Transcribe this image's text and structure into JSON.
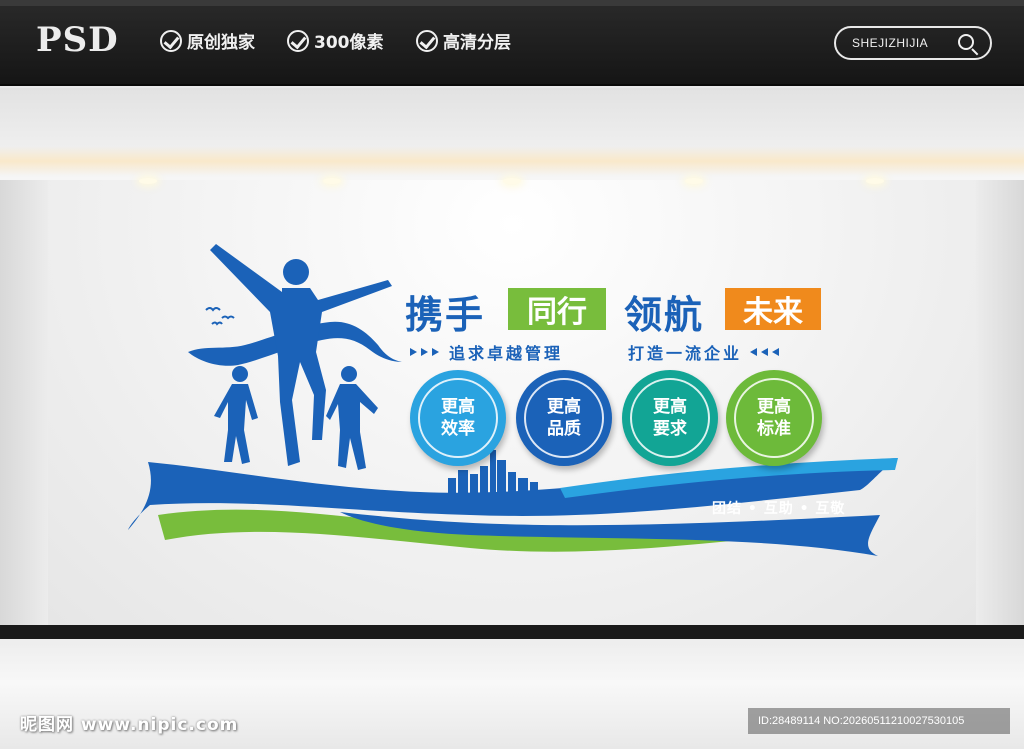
{
  "header": {
    "logo": "PSD",
    "features": [
      "原创独家",
      "300像素",
      "高清分层"
    ],
    "search_label": "SHEJIZHIJIA"
  },
  "wall": {
    "title_part1": "携手",
    "title_part2": "同行",
    "title_part3": "领航",
    "title_part4": "未来",
    "slogan_left": "追求卓越管理",
    "slogan_right": "打造一流企业",
    "circles": [
      {
        "line1": "更高",
        "line2": "效率",
        "color": "#2aa3e0"
      },
      {
        "line1": "更高",
        "line2": "品质",
        "color": "#1b62b8"
      },
      {
        "line1": "更高",
        "line2": "要求",
        "color": "#12a595"
      },
      {
        "line1": "更高",
        "line2": "标准",
        "color": "#6dba3a"
      }
    ],
    "motto": "团结 • 互助 • 互敬"
  },
  "colors": {
    "brand_blue": "#1b62b8",
    "green": "#78bd3c",
    "orange": "#f08a1c",
    "light_blue": "#2aa3e0"
  },
  "watermark": {
    "left": "昵图网 www.nipic.com",
    "right": "ID:28489114 NO:20260511210027530105"
  }
}
